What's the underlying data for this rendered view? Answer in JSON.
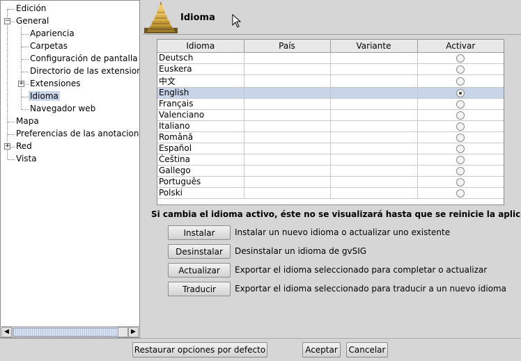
{
  "tree": {
    "items": [
      {
        "label": "Edición"
      },
      {
        "label": "General"
      },
      {
        "label": "Apariencia"
      },
      {
        "label": "Carpetas"
      },
      {
        "label": "Configuración de pantalla"
      },
      {
        "label": "Directorio de las extensiones"
      },
      {
        "label": "Extensiones"
      },
      {
        "label": "Idioma"
      },
      {
        "label": "Navegador web"
      },
      {
        "label": "Mapa"
      },
      {
        "label": "Preferencias de las anotaciones"
      },
      {
        "label": "Red"
      },
      {
        "label": "Vista"
      }
    ]
  },
  "header": {
    "title": "Idioma"
  },
  "table": {
    "columns": [
      "Idioma",
      "País",
      "Variante",
      "Activar"
    ],
    "rows": [
      {
        "idioma": "Deutsch",
        "pais": "",
        "variante": "",
        "activar": false
      },
      {
        "idioma": "Euskera",
        "pais": "",
        "variante": "",
        "activar": false
      },
      {
        "idioma": "中文",
        "pais": "",
        "variante": "",
        "activar": false
      },
      {
        "idioma": "English",
        "pais": "",
        "variante": "",
        "activar": true
      },
      {
        "idioma": "Français",
        "pais": "",
        "variante": "",
        "activar": false
      },
      {
        "idioma": "Valenciano",
        "pais": "",
        "variante": "",
        "activar": false
      },
      {
        "idioma": "Italiano",
        "pais": "",
        "variante": "",
        "activar": false
      },
      {
        "idioma": "Română",
        "pais": "",
        "variante": "",
        "activar": false
      },
      {
        "idioma": "Español",
        "pais": "",
        "variante": "",
        "activar": false
      },
      {
        "idioma": "Čeština",
        "pais": "",
        "variante": "",
        "activar": false
      },
      {
        "idioma": "Gallego",
        "pais": "",
        "variante": "",
        "activar": false
      },
      {
        "idioma": "Português",
        "pais": "",
        "variante": "",
        "activar": false
      },
      {
        "idioma": "Polski",
        "pais": "",
        "variante": "",
        "activar": false
      }
    ]
  },
  "notice": "Si cambia el idioma activo, éste no se visualizará hasta que se reinicie la aplicación",
  "actions": [
    {
      "label": "Instalar",
      "description": "Instalar un nuevo idioma o actualizar uno existente"
    },
    {
      "label": "Desinstalar",
      "description": "Desinstalar un idioma de gvSIG"
    },
    {
      "label": "Actualizar",
      "description": "Exportar el idioma seleccionado para completar o actualizar"
    },
    {
      "label": "Traducir",
      "description": "Exportar el idioma seleccionado para traducir a un nuevo idioma"
    }
  ],
  "footer": {
    "restore_label": "Restaurar opciones por defecto",
    "accept_label": "Aceptar",
    "cancel_label": "Cancelar"
  },
  "colors": {
    "selection": "#c8d4e8",
    "background": "#d6d6d6"
  }
}
